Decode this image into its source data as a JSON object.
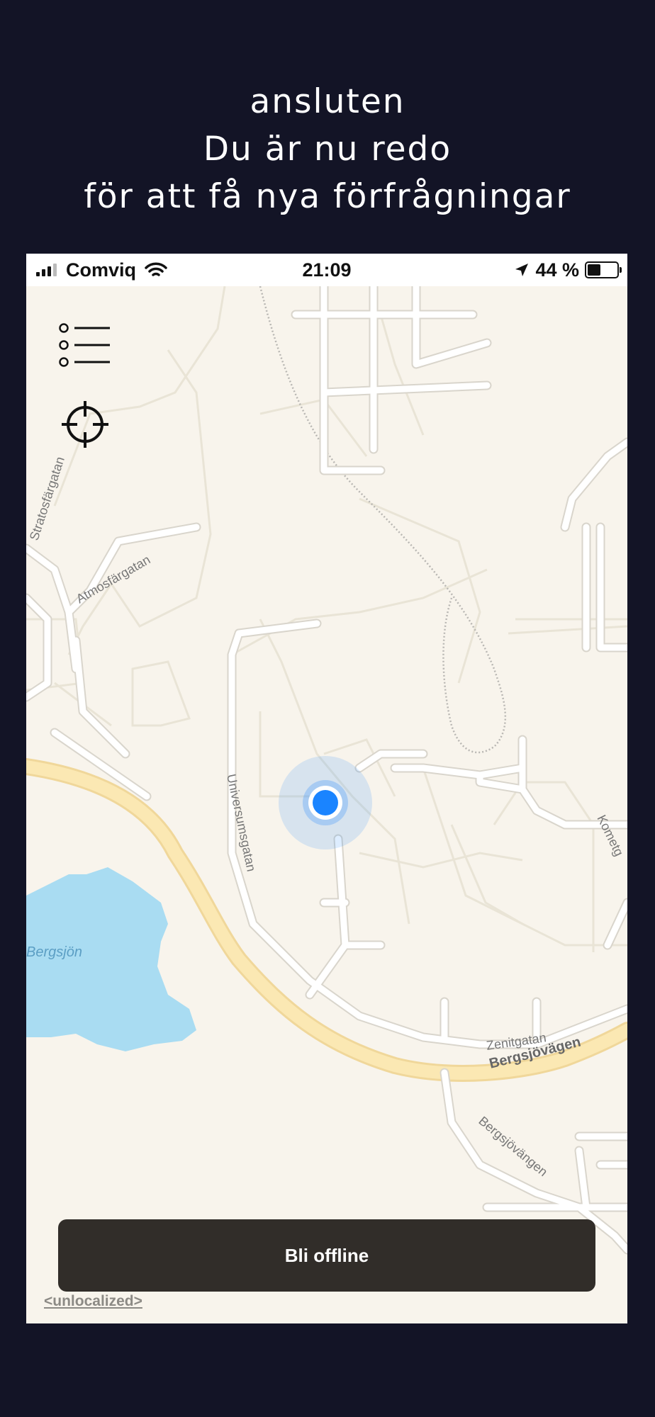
{
  "headline": {
    "line1": "ansluten",
    "line2": "Du är nu redo",
    "line3": "för att få nya förfrågningar"
  },
  "status_bar": {
    "carrier": "Comviq",
    "time": "21:09",
    "battery_percent": "44 %",
    "battery_level": 0.44,
    "signal_bars": 3
  },
  "map": {
    "labels": {
      "stratosfargatan": "Stratosfärgatan",
      "atmosfargatan": "Atmosfärgatan",
      "universumsgatan": "Universumsgatan",
      "bergsjon": "Bergsjön",
      "zenitgatan": "Zenitgatan",
      "bergsjovagen": "Bergsjövägen",
      "bergsjovangen": "Bergsjövängen",
      "kometgatan": "Kometg"
    },
    "colors": {
      "land": "#f8f4ec",
      "road": "#ffffff",
      "highway": "#fbe8b3",
      "water": "#a9dcf2",
      "user_dot": "#1a84ff"
    }
  },
  "controls": {
    "menu_icon": "list-icon",
    "locate_icon": "crosshair-icon",
    "offline_button_label": "Bli offline",
    "unlocalized_label": "<unlocalized>"
  }
}
